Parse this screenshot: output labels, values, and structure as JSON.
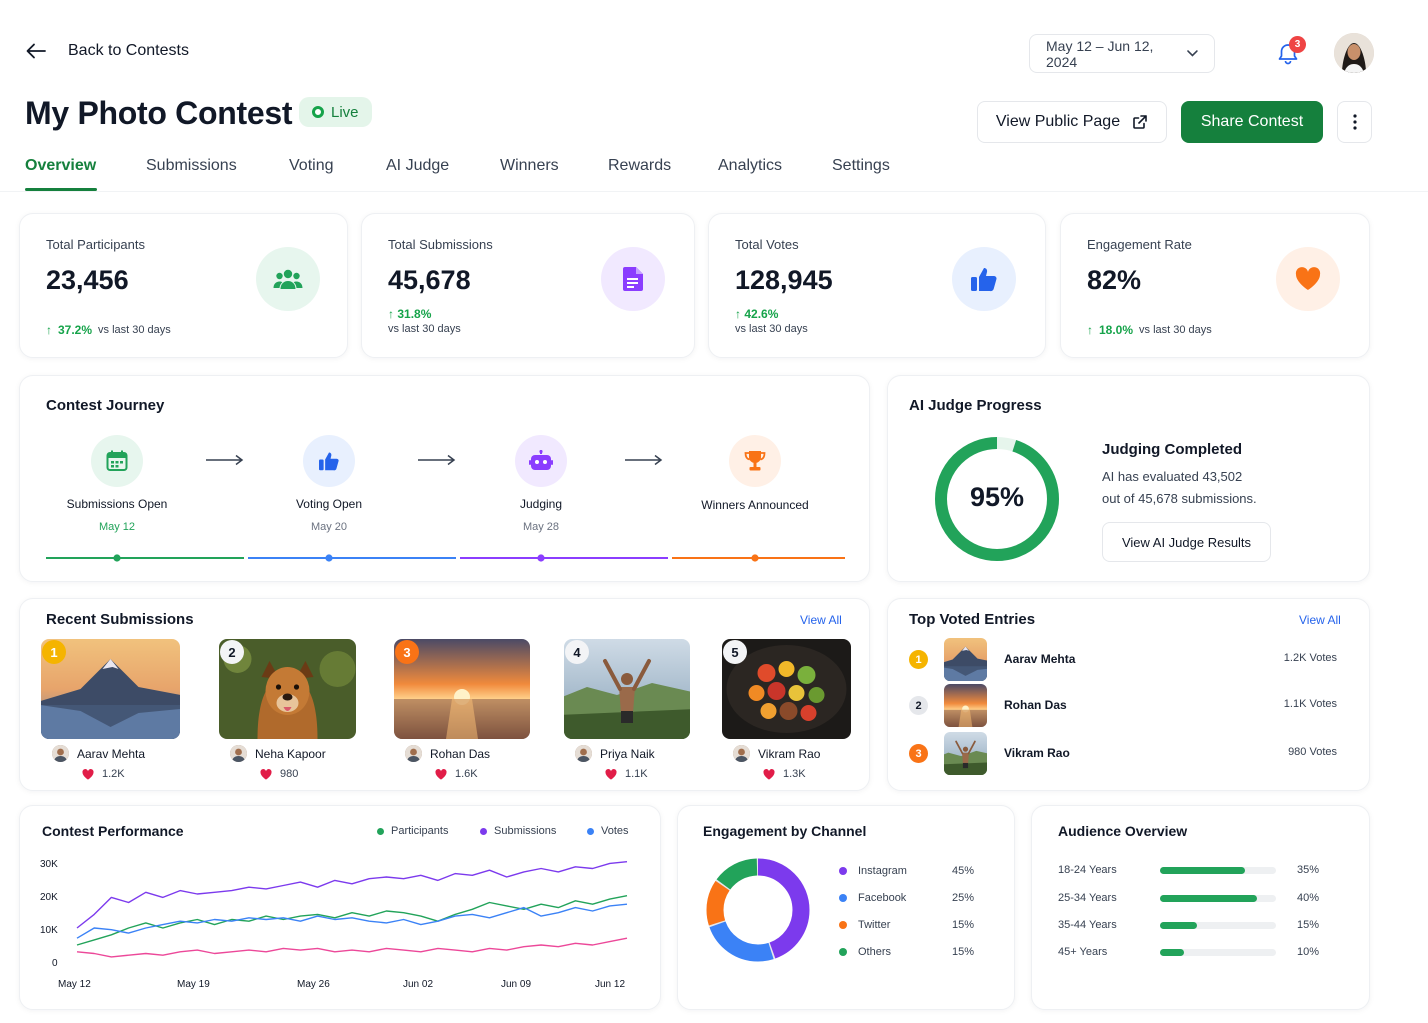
{
  "header": {
    "back_label": "Back to Contests",
    "title": "My Photo Contest",
    "status": "Live",
    "date_range": "May 12 – Jun 12, 2024",
    "notification_count": "3",
    "view_public_label": "View Public Page",
    "share_label": "Share Contest"
  },
  "tabs": [
    {
      "label": "Overview",
      "active": true
    },
    {
      "label": "Submissions"
    },
    {
      "label": "Voting"
    },
    {
      "label": "AI Judge"
    },
    {
      "label": "Winners"
    },
    {
      "label": "Rewards"
    },
    {
      "label": "Analytics"
    },
    {
      "label": "Settings"
    }
  ],
  "stats": [
    {
      "label": "Total Participants",
      "value": "23,456",
      "change": "37.2%",
      "sub": "vs last 30 days",
      "icon": "users-icon",
      "color": "#22a35a",
      "bg": "#e7f6ee"
    },
    {
      "label": "Total Submissions",
      "value": "45,678",
      "change": "31.8%",
      "sub": "vs last 30 days",
      "icon": "document-icon",
      "color": "#8b3dff",
      "bg": "#f1e9ff"
    },
    {
      "label": "Total Votes",
      "value": "128,945",
      "change": "42.6%",
      "sub": "vs last 30 days",
      "icon": "thumbs-up-icon",
      "color": "#2563eb",
      "bg": "#e8f0fe"
    },
    {
      "label": "Engagement Rate",
      "value": "82%",
      "change": "18.0%",
      "sub": "vs last 30 days",
      "icon": "heart-icon",
      "color": "#f97316",
      "bg": "#fff0e6"
    }
  ],
  "journey": {
    "title": "Contest Journey",
    "steps": [
      {
        "label": "Submissions Open",
        "date": "May 12",
        "icon": "calendar-icon",
        "color": "#22a35a",
        "bg": "#e7f6ee"
      },
      {
        "label": "Voting Open",
        "date": "May 20",
        "icon": "thumbs-up-icon",
        "color": "#2563eb",
        "bg": "#e8f0fe"
      },
      {
        "label": "Judging",
        "date": "May 28",
        "icon": "robot-icon",
        "color": "#8b3dff",
        "bg": "#f1e9ff"
      },
      {
        "label": "Winners Announced",
        "date": "",
        "icon": "trophy-icon",
        "color": "#f97316",
        "bg": "#fff0e6"
      }
    ]
  },
  "ai_judge": {
    "title": "AI Judge Progress",
    "percent": 95,
    "percent_label": "95%",
    "heading": "Judging Completed",
    "desc_line1": "AI has evaluated 43,502",
    "desc_line2": "out of 45,678 submissions.",
    "button": "View AI Judge Results"
  },
  "recent": {
    "title": "Recent Submissions",
    "view_all": "View All",
    "items": [
      {
        "rank": "1",
        "name": "Aarav Mehta",
        "likes": "1.2K",
        "scene": "mountain"
      },
      {
        "rank": "2",
        "name": "Neha Kapoor",
        "likes": "980",
        "scene": "dog"
      },
      {
        "rank": "3",
        "name": "Rohan Das",
        "likes": "1.6K",
        "scene": "sunset"
      },
      {
        "rank": "4",
        "name": "Priya Naik",
        "likes": "1.1K",
        "scene": "hiker"
      },
      {
        "rank": "5",
        "name": "Vikram Rao",
        "likes": "1.3K",
        "scene": "food"
      }
    ]
  },
  "top_voted": {
    "title": "Top Voted Entries",
    "view_all": "View All",
    "items": [
      {
        "rank": "1",
        "name": "Aarav Mehta",
        "votes": "1.2K Votes",
        "scene": "mountain"
      },
      {
        "rank": "2",
        "name": "Rohan Das",
        "votes": "1.1K Votes",
        "scene": "sunset"
      },
      {
        "rank": "3",
        "name": "Vikram Rao",
        "votes": "980 Votes",
        "scene": "hiker"
      }
    ]
  },
  "performance": {
    "title": "Contest Performance",
    "legend": [
      {
        "name": "Participants",
        "color": "#22a35a"
      },
      {
        "name": "Submissions",
        "color": "#7c3aed"
      },
      {
        "name": "Votes",
        "color": "#3b82f6"
      }
    ]
  },
  "chart_data": {
    "type": "line",
    "x": [
      "May 12",
      "May 19",
      "May 26",
      "Jun 02",
      "Jun 09",
      "Jun 12"
    ],
    "y_ticks": [
      "30K",
      "20K",
      "10K",
      "0"
    ],
    "ylim": [
      0,
      30000
    ],
    "series": [
      {
        "name": "Submissions",
        "color": "#7c3aed",
        "values": [
          10000,
          14000,
          19000,
          17500,
          20500,
          19000,
          21000,
          20000,
          20500,
          21000,
          22000,
          21500,
          22500,
          23500,
          22000,
          24000,
          23000,
          24500,
          25000,
          24500,
          25500,
          24000,
          26000,
          25500,
          27000,
          25000,
          26500,
          27500,
          26500,
          28000,
          27500,
          29000,
          29500
        ]
      },
      {
        "name": "Participants",
        "color": "#22a35a",
        "values": [
          5000,
          6500,
          8000,
          10000,
          11500,
          10000,
          11500,
          12500,
          11000,
          12500,
          12000,
          13500,
          12500,
          13500,
          14000,
          13000,
          14500,
          13500,
          15000,
          14500,
          13500,
          12000,
          14000,
          15500,
          17500,
          16500,
          15500,
          17000,
          16000,
          18000,
          17000,
          18500,
          19500
        ]
      },
      {
        "name": "Votes",
        "color": "#3b82f6",
        "values": [
          7000,
          10000,
          9500,
          8500,
          10000,
          11000,
          12000,
          11500,
          12500,
          12000,
          13000,
          12500,
          13000,
          12000,
          13500,
          12500,
          13000,
          12000,
          11500,
          12500,
          11000,
          12000,
          13500,
          14000,
          13000,
          14500,
          16000,
          13500,
          14500,
          16000,
          15000,
          16500,
          17000
        ]
      },
      {
        "name": "",
        "color": "#ec4899",
        "values": [
          3000,
          2500,
          1500,
          2000,
          2500,
          2000,
          3000,
          3500,
          2500,
          3000,
          3500,
          3000,
          4000,
          3500,
          4000,
          3000,
          3500,
          3000,
          4000,
          3500,
          3000,
          4000,
          3500,
          3000,
          4000,
          3500,
          4500,
          5000,
          4500,
          5500,
          5000,
          6000,
          7000
        ]
      }
    ]
  },
  "channels": {
    "title": "Engagement by Channel",
    "items": [
      {
        "name": "Instagram",
        "pct": "45%",
        "value": 45,
        "color": "#7c3aed"
      },
      {
        "name": "Facebook",
        "pct": "25%",
        "value": 25,
        "color": "#3b82f6"
      },
      {
        "name": "Twitter",
        "pct": "15%",
        "value": 15,
        "color": "#f97316"
      },
      {
        "name": "Others",
        "pct": "15%",
        "value": 15,
        "color": "#22a35a"
      }
    ]
  },
  "audience": {
    "title": "Audience Overview",
    "items": [
      {
        "label": "18-24 Years",
        "pct": "35%",
        "value": 35
      },
      {
        "label": "25-34 Years",
        "pct": "40%",
        "value": 40
      },
      {
        "label": "35-44 Years",
        "pct": "15%",
        "value": 15
      },
      {
        "label": "45+ Years",
        "pct": "10%",
        "value": 10
      }
    ]
  }
}
